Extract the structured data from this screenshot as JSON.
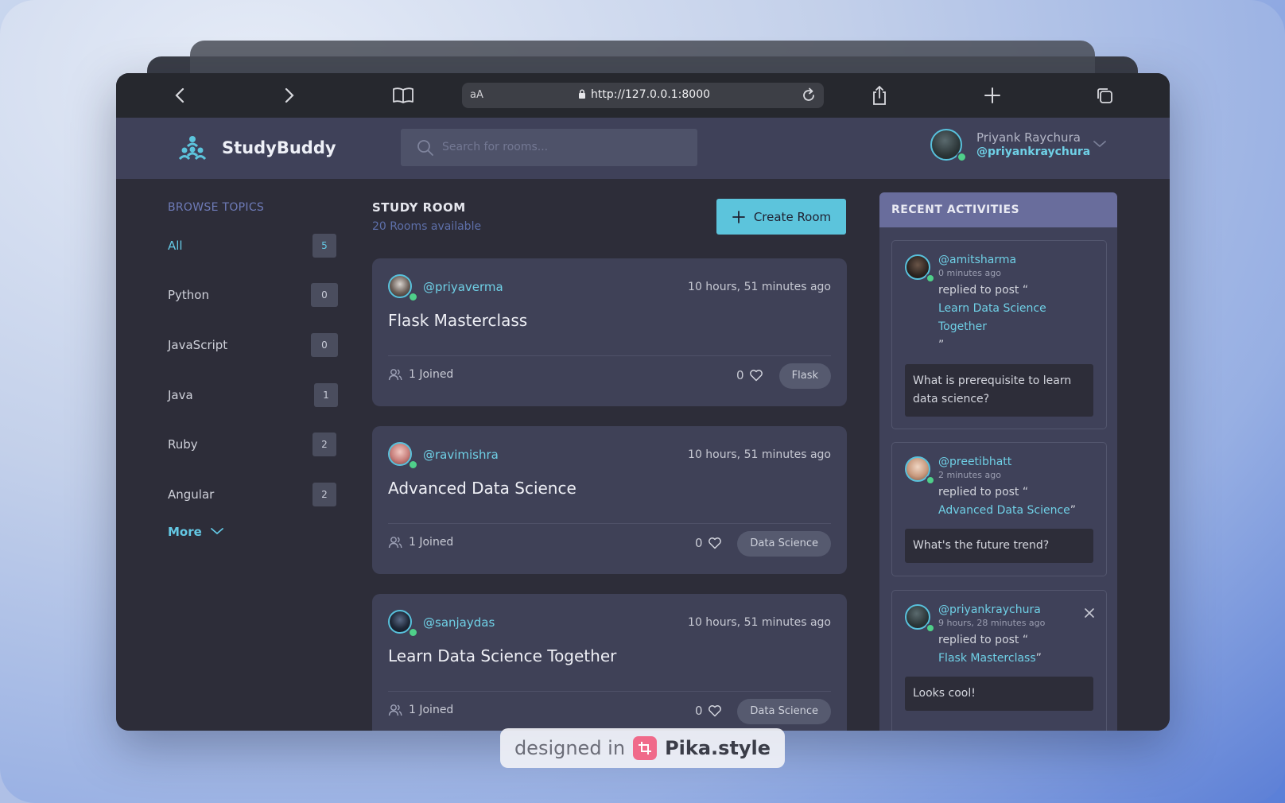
{
  "browser": {
    "text_size_label": "aA",
    "url": "http://127.0.0.1:8000"
  },
  "nav": {
    "brand": "StudyBuddy",
    "search_placeholder": "Search for rooms...",
    "user_name": "Priyank Raychura",
    "user_handle": "@priyankraychura"
  },
  "topics": {
    "title": "BROWSE TOPICS",
    "items": [
      {
        "label": "All",
        "count": "5"
      },
      {
        "label": "Python",
        "count": "0"
      },
      {
        "label": "JavaScript",
        "count": "0"
      },
      {
        "label": "Java",
        "count": "1"
      },
      {
        "label": "Ruby",
        "count": "2"
      },
      {
        "label": "Angular",
        "count": "2"
      }
    ],
    "more_label": "More"
  },
  "rooms": {
    "title": "STUDY ROOM",
    "subtitle": "20 Rooms available",
    "create_label": "Create Room",
    "items": [
      {
        "host": "@priyaverma",
        "time": "10 hours, 51 minutes ago",
        "name": "Flask Masterclass",
        "joined": "1 Joined",
        "likes": "0",
        "tag": "Flask"
      },
      {
        "host": "@ravimishra",
        "time": "10 hours, 51 minutes ago",
        "name": "Advanced Data Science",
        "joined": "1 Joined",
        "likes": "0",
        "tag": "Data Science"
      },
      {
        "host": "@sanjaydas",
        "time": "10 hours, 51 minutes ago",
        "name": "Learn Data Science Together",
        "joined": "1 Joined",
        "likes": "0",
        "tag": "Data Science"
      }
    ]
  },
  "activities": {
    "title": "RECENT ACTIVITIES",
    "items": [
      {
        "handle": "@amitsharma",
        "time": "0 minutes ago",
        "action": "replied to post “",
        "link_line1": "Learn Data Science",
        "link_line2": "Together",
        "close_quote": "”",
        "message": "What is prerequisite to learn data science?"
      },
      {
        "handle": "@preetibhatt",
        "time": "2 minutes ago",
        "action": "replied to post “",
        "link": "Advanced Data Science",
        "close_quote": "”",
        "message": "What's the future trend?"
      },
      {
        "handle": "@priyankraychura",
        "time": "9 hours, 28 minutes ago",
        "action": "replied to post “",
        "link": "Flask Masterclass",
        "close_quote": "”",
        "message": "Looks cool!"
      }
    ]
  },
  "watermark": {
    "prefix": "designed in",
    "brand": "Pika.style"
  },
  "colors": {
    "accent": "#5cc4dc",
    "nav_bg": "#3f4159",
    "page_bg": "#2d2d39",
    "card_bg": "#3f4157",
    "activities_header": "#696d9c",
    "online": "#4fd08a"
  }
}
